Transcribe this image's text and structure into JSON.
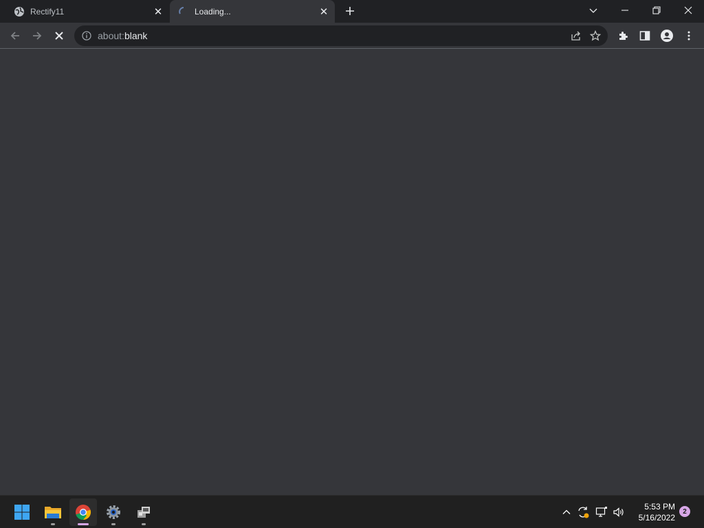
{
  "browser": {
    "tabs": [
      {
        "title": "Rectify11",
        "favicon": "globe-icon",
        "active": false
      },
      {
        "title": "Loading...",
        "favicon": "loading-spinner-icon",
        "active": true
      }
    ],
    "new_tab_icon": "plus-icon",
    "window_controls": [
      "chevron-down-icon",
      "minimize-icon",
      "restore-icon",
      "close-icon"
    ],
    "toolbar": {
      "url_scheme": "about:",
      "url_host": "blank",
      "nav_icons": [
        "back-arrow-icon",
        "forward-arrow-icon",
        "stop-loading-icon"
      ],
      "omnibox_actions": [
        "share-icon",
        "bookmark-star-icon"
      ],
      "actions": [
        "extensions-puzzle-icon",
        "side-panel-icon",
        "profile-icon",
        "menu-kebab-icon"
      ]
    }
  },
  "taskbar": {
    "apps": [
      {
        "name": "start",
        "icon": "windows-start-icon"
      },
      {
        "name": "file-explorer",
        "icon": "folder-icon"
      },
      {
        "name": "chrome",
        "icon": "chrome-icon",
        "active": true
      },
      {
        "name": "settings",
        "icon": "settings-gear-icon"
      },
      {
        "name": "installer",
        "icon": "installer-icon"
      }
    ],
    "tray": {
      "icons": [
        "chevron-up-icon",
        "sync-icon",
        "network-icon",
        "volume-icon"
      ],
      "time": "5:53 PM",
      "date": "5/16/2022",
      "notification_count": "2"
    }
  },
  "colors": {
    "tabstrip_bg": "#202124",
    "toolbar_bg": "#35363a",
    "content_bg": "#35363a",
    "omnibox_bg": "#202124",
    "taskbar_bg": "#202020",
    "accent": "#d7a6e6"
  }
}
